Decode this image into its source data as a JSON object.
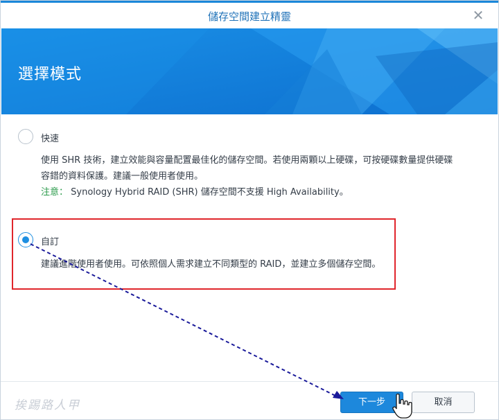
{
  "dialog": {
    "title": "儲存空間建立精靈",
    "banner_title": "選擇模式"
  },
  "options": [
    {
      "label": "快速",
      "selected": false,
      "desc_line1": "使用 SHR 技術，建立效能與容量配置最佳化的儲存空間。若使用兩顆以上硬碟，可按硬碟數量提供硬碟",
      "desc_line2": "容錯的資料保護。建議一般使用者使用。",
      "note_label": "注意：",
      "note_text": " Synology Hybrid RAID (SHR) 儲存空間不支援 High Availability。"
    },
    {
      "label": "自訂",
      "selected": true,
      "desc_line1": "建議進階使用者使用。可依照個人需求建立不同類型的 RAID，並建立多個儲存空間。"
    }
  ],
  "footer": {
    "next_label": "下一步",
    "cancel_label": "取消",
    "watermark": "挨踢路人甲"
  },
  "colors": {
    "accent": "#1d88dc",
    "highlight": "#e0252b",
    "annotation_arrow": "#1a1a9a"
  }
}
